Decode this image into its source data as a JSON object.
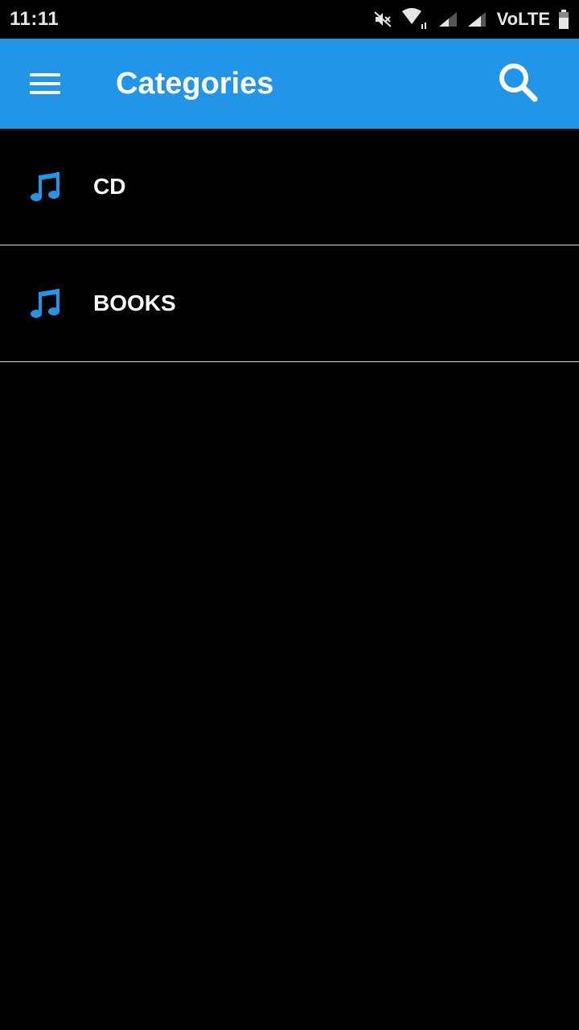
{
  "status_bar": {
    "time": "11:11",
    "network_label": "VoLTE",
    "icons": [
      "mute-icon",
      "wifi-icon",
      "signal-icon",
      "signal-icon",
      "battery-icon"
    ]
  },
  "app_bar": {
    "title": "Categories",
    "menu_icon": "hamburger-menu-icon",
    "search_icon": "search-icon",
    "background": "#2196e8"
  },
  "categories": [
    {
      "label": "CD",
      "icon": "music-note-icon"
    },
    {
      "label": "BOOKS",
      "icon": "music-note-icon"
    }
  ],
  "colors": {
    "accent": "#2196e8",
    "background": "#000000",
    "text": "#ffffff",
    "divider": "#d8d8d8"
  }
}
